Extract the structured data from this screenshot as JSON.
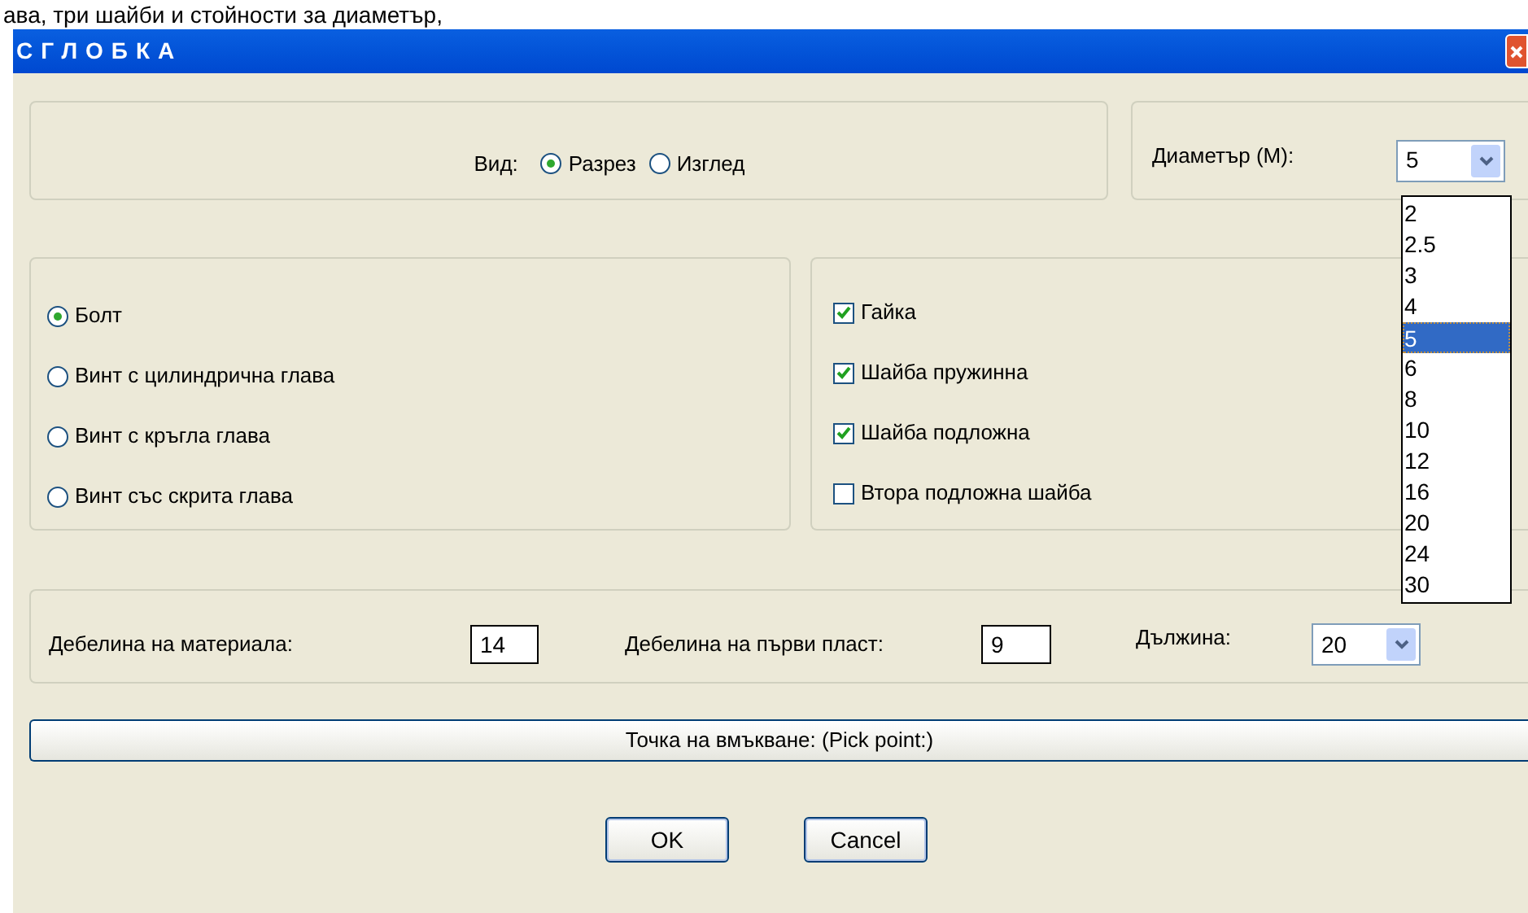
{
  "caption": "ава, три шайби и стойности за диаметър,",
  "window": {
    "title": "СГЛОБКА"
  },
  "view": {
    "label": "Вид:",
    "options": [
      {
        "label": "Разрез",
        "selected": true
      },
      {
        "label": "Изглед",
        "selected": false
      }
    ]
  },
  "diameter": {
    "label": "Диаметър (М):",
    "value": "5",
    "expanded": true,
    "options": [
      {
        "label": "2",
        "selected": false
      },
      {
        "label": "2.5",
        "selected": false
      },
      {
        "label": "3",
        "selected": false
      },
      {
        "label": "4",
        "selected": false
      },
      {
        "label": "5",
        "selected": true
      },
      {
        "label": "6",
        "selected": false
      },
      {
        "label": "8",
        "selected": false
      },
      {
        "label": "10",
        "selected": false
      },
      {
        "label": "12",
        "selected": false
      },
      {
        "label": "16",
        "selected": false
      },
      {
        "label": "20",
        "selected": false
      },
      {
        "label": "24",
        "selected": false
      },
      {
        "label": "30",
        "selected": false
      }
    ]
  },
  "fastener_types": [
    {
      "label": "Болт",
      "selected": true
    },
    {
      "label": "Винт с цилиндрична глава",
      "selected": false
    },
    {
      "label": "Винт с кръгла глава",
      "selected": false
    },
    {
      "label": "Винт със скрита глава",
      "selected": false
    }
  ],
  "parts": [
    {
      "label": "Гайка",
      "checked": true
    },
    {
      "label": "Шайба пружинна",
      "checked": true
    },
    {
      "label": "Шайба подложна",
      "checked": true
    },
    {
      "label": "Втора подложна шайба",
      "checked": false
    }
  ],
  "material_thickness": {
    "label": "Дебелина на материала:",
    "value": "14"
  },
  "first_layer_thickness": {
    "label": "Дебелина на първи пласт:",
    "value": "9"
  },
  "length": {
    "label": "Дължина:",
    "value": "20"
  },
  "pick_point_button": "Точка на вмъкване: (Pick point:)",
  "buttons": [
    "OK",
    "Cancel"
  ]
}
